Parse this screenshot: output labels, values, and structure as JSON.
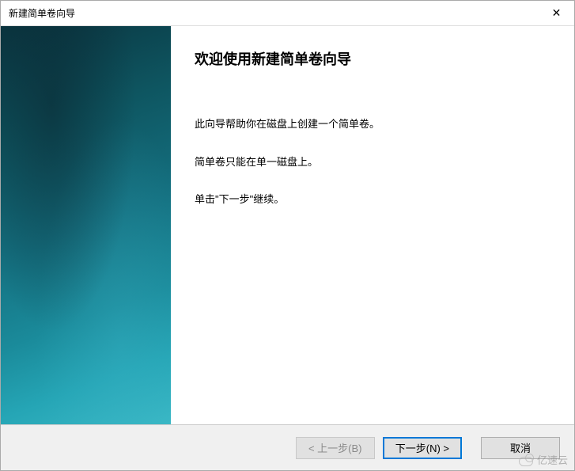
{
  "titlebar": {
    "title": "新建简单卷向导"
  },
  "content": {
    "heading": "欢迎使用新建简单卷向导",
    "line1": "此向导帮助你在磁盘上创建一个简单卷。",
    "line2": "简单卷只能在单一磁盘上。",
    "line3": "单击\"下一步\"继续。"
  },
  "buttons": {
    "back": "< 上一步(B)",
    "next": "下一步(N) >",
    "cancel": "取消"
  },
  "watermark": {
    "text": "亿速云"
  }
}
